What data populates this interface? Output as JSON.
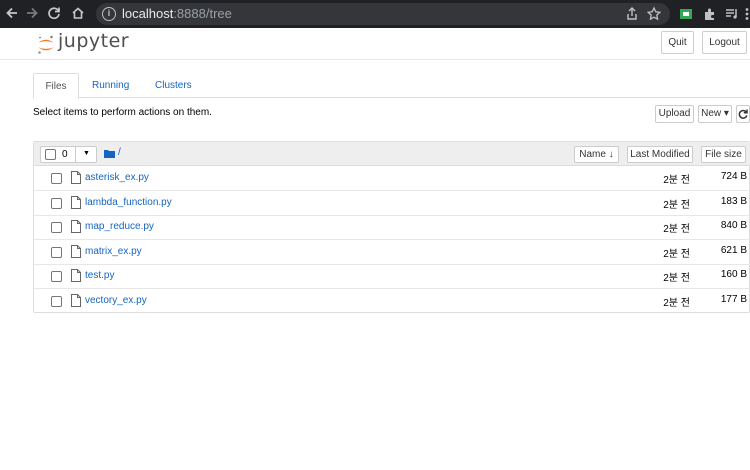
{
  "browser": {
    "url_host": "localhost",
    "url_rest": ":8888/tree"
  },
  "header": {
    "logo_text": "jupyter",
    "quit_label": "Quit",
    "logout_label": "Logout"
  },
  "tabs": [
    {
      "label": "Files",
      "active": true
    },
    {
      "label": "Running",
      "active": false
    },
    {
      "label": "Clusters",
      "active": false
    }
  ],
  "toolbar": {
    "select_message": "Select items to perform actions on them.",
    "upload_label": "Upload",
    "new_label": "New ▾",
    "refresh_icon": "refresh-icon"
  },
  "list_header": {
    "selected_count": "0",
    "breadcrumb": "/",
    "sort_name": "Name 🡫",
    "sort_last_modified": "Last Modified",
    "sort_file_size": "File size"
  },
  "files": [
    {
      "name": "asterisk_ex.py",
      "modified": "2분 전",
      "size": "724 B"
    },
    {
      "name": "lambda_function.py",
      "modified": "2분 전",
      "size": "183 B"
    },
    {
      "name": "map_reduce.py",
      "modified": "2분 전",
      "size": "840 B"
    },
    {
      "name": "matrix_ex.py",
      "modified": "2분 전",
      "size": "621 B"
    },
    {
      "name": "test.py",
      "modified": "2분 전",
      "size": "160 B"
    },
    {
      "name": "vectory_ex.py",
      "modified": "2분 전",
      "size": "177 B"
    }
  ],
  "colors": {
    "link": "#1565c0",
    "logo_orange": "#f37726",
    "browser_bg": "#202124"
  }
}
